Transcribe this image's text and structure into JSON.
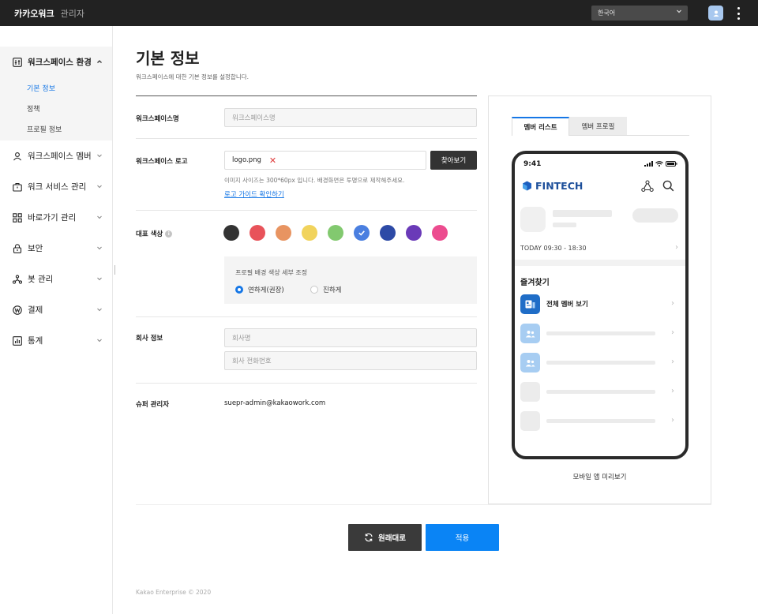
{
  "header": {
    "brand": "카카오워크",
    "brand_sub": "관리자",
    "language_value": "한국어"
  },
  "sidebar": {
    "items": [
      {
        "label": "워크스페이스 환경",
        "icon": "sliders-icon",
        "expanded": true
      },
      {
        "label": "워크스페이스 멤버",
        "icon": "user-icon"
      },
      {
        "label": "워크 서비스 관리",
        "icon": "briefcase-icon"
      },
      {
        "label": "바로가기 관리",
        "icon": "grid-icon"
      },
      {
        "label": "보안",
        "icon": "lock-icon"
      },
      {
        "label": "봇 관리",
        "icon": "bot-icon"
      },
      {
        "label": "결제",
        "icon": "won-icon"
      },
      {
        "label": "통계",
        "icon": "chart-icon"
      }
    ],
    "subitems": [
      {
        "label": "기본 정보",
        "active": true
      },
      {
        "label": "정책"
      },
      {
        "label": "프로필 정보"
      }
    ]
  },
  "page": {
    "title": "기본 정보",
    "description": "워크스페이스에 대한 기본 정보를 설정합니다."
  },
  "form": {
    "workspace_name": {
      "label": "워크스페이스명",
      "placeholder": "워크스페이스명"
    },
    "workspace_logo": {
      "label": "워크스페이스 로고",
      "file_value": "logo.png",
      "browse_label": "찾아보기",
      "hint": "이미지 사이즈는 300*60px 입니다. 배경화면은 투명으로 제작해주세요.",
      "guide_link": "로고 가이드 확인하기"
    },
    "brand_color": {
      "label": "대표 색상",
      "swatches": [
        "#333333",
        "#e8535a",
        "#e89461",
        "#f1d35c",
        "#82c96f",
        "#4a7fe0",
        "#2d4aa6",
        "#6a3ab8",
        "#ec4c8f"
      ],
      "selected_index": 5,
      "adjust_title": "프로필 배경 색상 세부 조정",
      "options": [
        {
          "label": "연하게(권장)",
          "selected": true
        },
        {
          "label": "진하게",
          "selected": false
        }
      ]
    },
    "company_info": {
      "label": "회사 정보",
      "name_placeholder": "회사명",
      "phone_placeholder": "회사 전화번호"
    },
    "super_admin": {
      "label": "슈퍼 관리자",
      "value": "suepr-admin@kakaowork.com"
    }
  },
  "actions": {
    "reset_label": "원래대로",
    "apply_label": "적용"
  },
  "preview": {
    "tabs": [
      "멤버 리스트",
      "멤버 프로필"
    ],
    "phone": {
      "time": "9:41",
      "brand": "FINTECH",
      "today": "TODAY  09:30 - 18:30",
      "favorites_title": "즐겨찾기",
      "first_item": "전체 멤버 보기"
    },
    "caption": "모바일 앱 미리보기"
  },
  "footer": "Kakao Enterprise © 2020",
  "colors": {
    "accent": "#1677e6",
    "apply": "#0a84f5",
    "topbar": "#222222"
  }
}
